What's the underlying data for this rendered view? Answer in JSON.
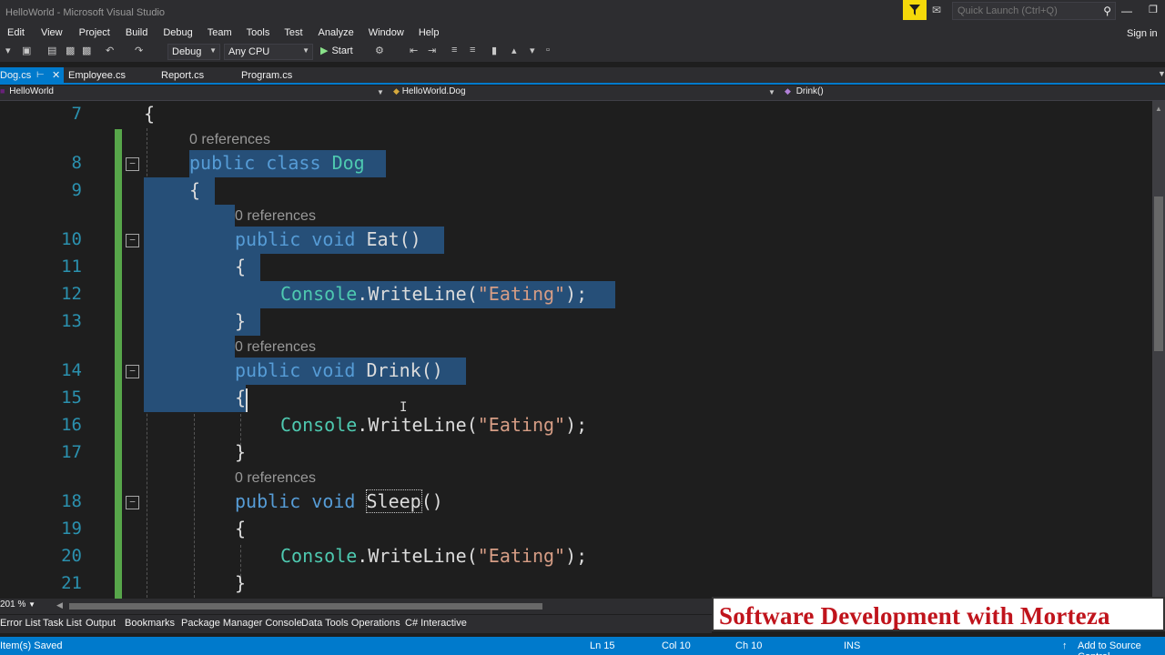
{
  "window": {
    "title": "HelloWorld - Microsoft Visual Studio",
    "quick_launch_placeholder": "Quick Launch (Ctrl+Q)",
    "sign_in": "Sign in"
  },
  "menu": [
    "Edit",
    "View",
    "Project",
    "Build",
    "Debug",
    "Team",
    "Tools",
    "Test",
    "Analyze",
    "Window",
    "Help"
  ],
  "toolbar": {
    "configuration": "Debug",
    "platform": "Any CPU",
    "start_label": "Start"
  },
  "tabs": [
    {
      "label": "Dog.cs",
      "active": true
    },
    {
      "label": "Employee.cs",
      "active": false
    },
    {
      "label": "Report.cs",
      "active": false
    },
    {
      "label": "Program.cs",
      "active": false
    }
  ],
  "navbar": {
    "project": "HelloWorld",
    "type": "HelloWorld.Dog",
    "member": "Drink()"
  },
  "editor": {
    "codelens": "0 references",
    "lines": [
      {
        "n": "7",
        "text": "{"
      },
      {
        "n": "8",
        "text": "public class Dog"
      },
      {
        "n": "9",
        "text": "{"
      },
      {
        "n": "10",
        "text": "public void Eat()"
      },
      {
        "n": "11",
        "text": "{"
      },
      {
        "n": "12",
        "text": "Console.WriteLine(\"Eating\");"
      },
      {
        "n": "13",
        "text": "}"
      },
      {
        "n": "14",
        "text": "public void Drink()"
      },
      {
        "n": "15",
        "text": "{"
      },
      {
        "n": "16",
        "text": "Console.WriteLine(\"Eating\");"
      },
      {
        "n": "17",
        "text": "}"
      },
      {
        "n": "18",
        "text": "public void Sleep()"
      },
      {
        "n": "19",
        "text": "{"
      },
      {
        "n": "20",
        "text": "Console.WriteLine(\"Eating\");"
      },
      {
        "n": "21",
        "text": "}"
      }
    ]
  },
  "zoom": "201 %",
  "tool_windows": [
    "Error List",
    "Task List",
    "Output",
    "Bookmarks",
    "Package Manager Console",
    "Data Tools Operations",
    "C# Interactive"
  ],
  "status": {
    "message": "Item(s) Saved",
    "ln": "Ln 15",
    "col": "Col 10",
    "ch": "Ch 10",
    "mode": "INS",
    "source_control": "Add to Source Control"
  },
  "watermark": "Software Development with Morteza",
  "colors": {
    "keyword": "#569cd6",
    "type": "#4ec9b0",
    "string": "#d69d85",
    "selection": "#264f78",
    "accent": "#007acc",
    "line_number": "#2b91af"
  }
}
